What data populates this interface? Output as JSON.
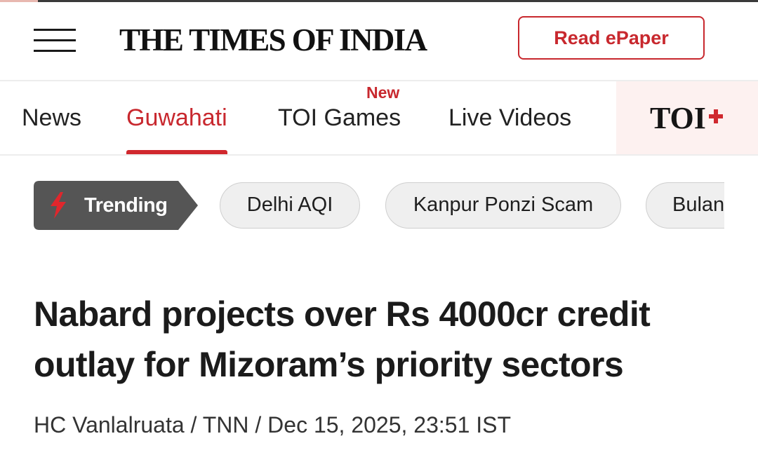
{
  "header": {
    "logo": "THE TIMES OF INDIA",
    "epaper_label": "Read ePaper"
  },
  "nav": {
    "items": [
      {
        "label": "News"
      },
      {
        "label": "Guwahati",
        "active": true
      },
      {
        "label": "TOI Games",
        "badge": "New"
      },
      {
        "label": "Live Videos"
      }
    ],
    "toi_plus": "TOI"
  },
  "trending": {
    "label": "Trending",
    "chips": [
      "Delhi AQI",
      "Kanpur Ponzi Scam",
      "Bulan"
    ]
  },
  "article": {
    "headline": "Nabard projects over Rs 4000cr credit outlay for Mizoram’s priority sectors",
    "byline": "HC Vanlalruata / TNN / Dec 15, 2025, 23:51 IST"
  },
  "colors": {
    "brand_red": "#c8282e",
    "trending_bg": "#555555",
    "toi_plus_bg": "#fdf1f0"
  }
}
